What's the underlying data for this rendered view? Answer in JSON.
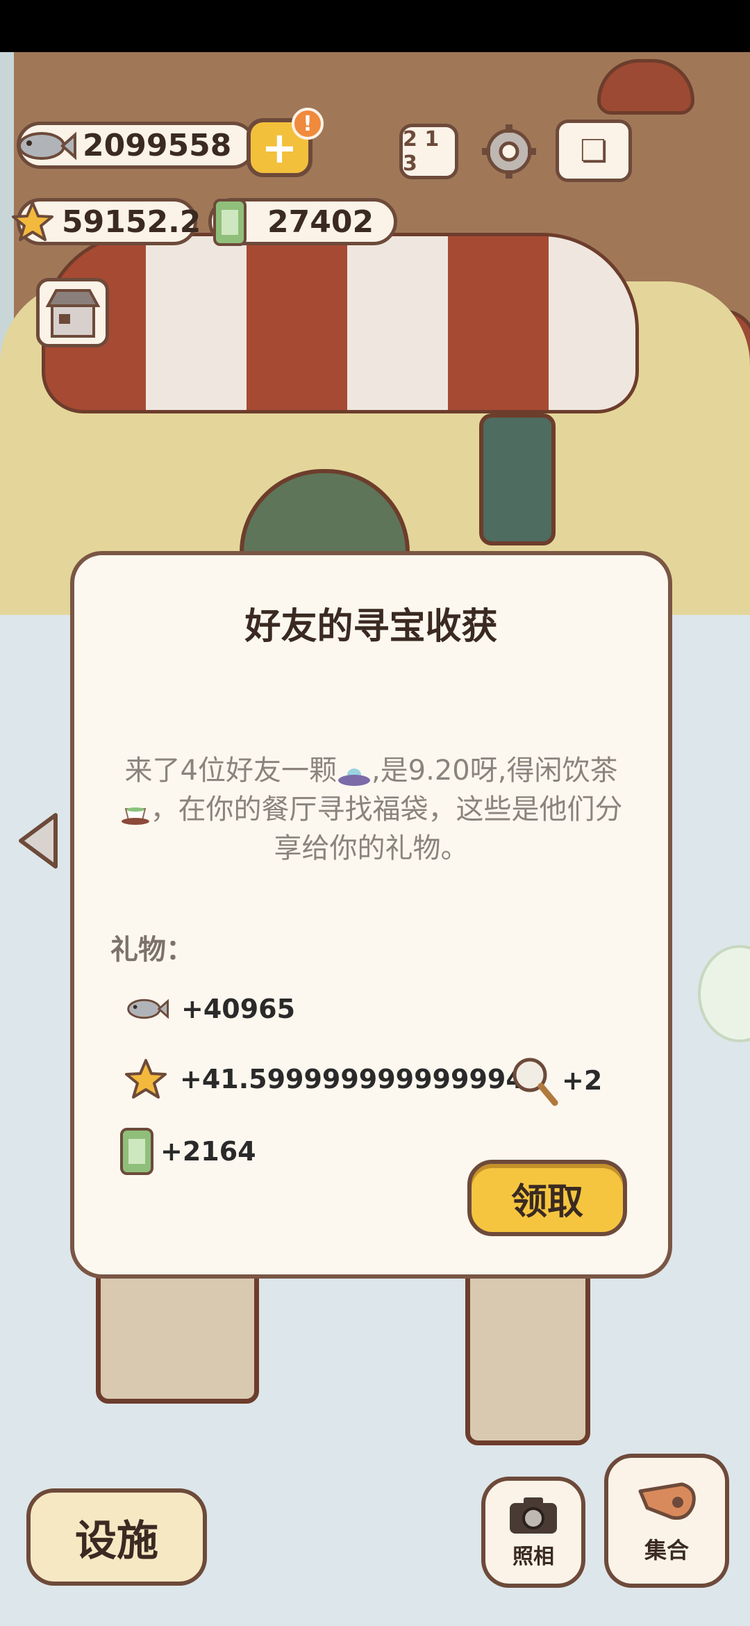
{
  "hud": {
    "fish_count": "2099558",
    "star_count": "59152.2",
    "ticket_count": "27402",
    "alert_badge": "!"
  },
  "dialog": {
    "title": "好友的寻宝收获",
    "message_part1": "来了4位好友一颗",
    "message_part2": ",是9.20呀,得闲饮茶",
    "message_part3": "，在你的餐厅寻找福袋，这些是他们分享给你的礼物。",
    "gifts_label": "礼物：",
    "gifts": {
      "fish": "+40965",
      "star": "+41.599999999999994",
      "magnifier": "+2",
      "ticket": "+2164"
    },
    "claim_label": "领取"
  },
  "bottom": {
    "facilities_label": "设施",
    "photo_label": "照相",
    "gather_label": "集合"
  },
  "icons": [
    "fish-icon",
    "plus-icon",
    "star-icon",
    "ticket-icon",
    "podium-icon",
    "gear-icon",
    "book-icon",
    "shop-icon",
    "ufo-icon",
    "tea-icon",
    "magnifier-icon",
    "camera-icon",
    "whistle-icon",
    "left-arrow-icon"
  ]
}
